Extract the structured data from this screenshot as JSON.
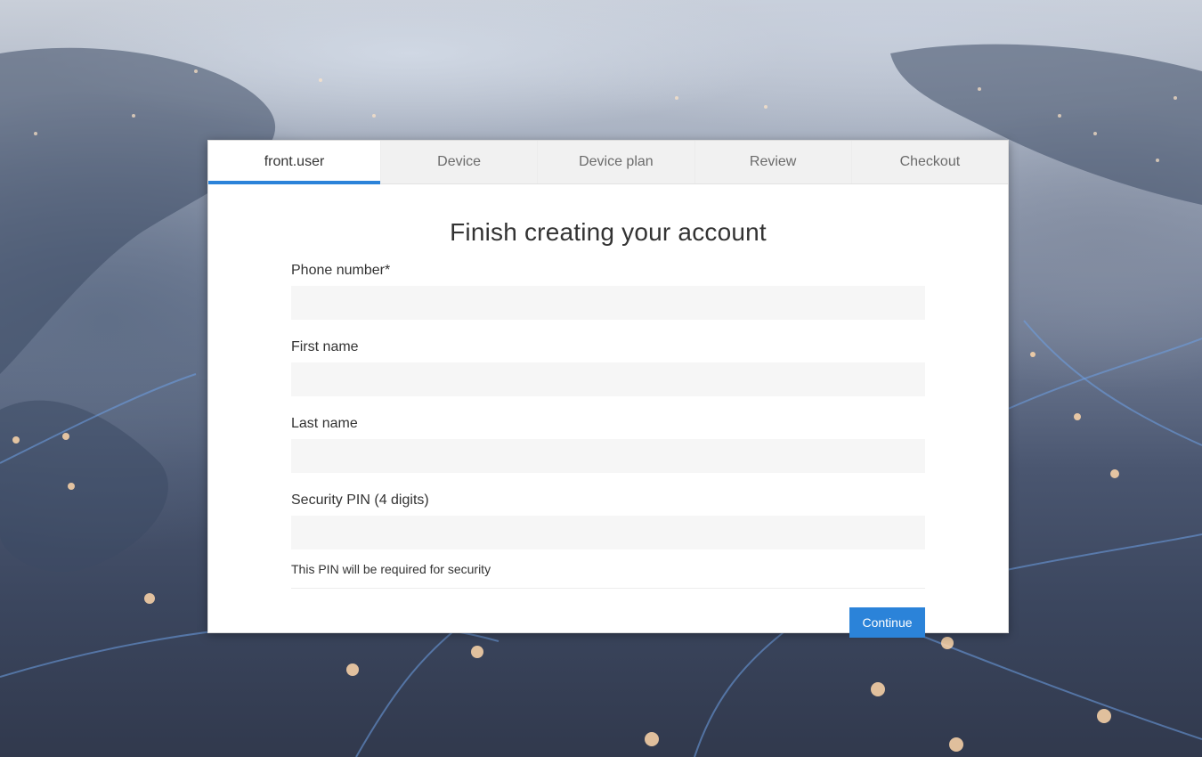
{
  "tabs": [
    {
      "label": "front.user",
      "active": true
    },
    {
      "label": "Device",
      "active": false
    },
    {
      "label": "Device plan",
      "active": false
    },
    {
      "label": "Review",
      "active": false
    },
    {
      "label": "Checkout",
      "active": false
    }
  ],
  "form": {
    "title": "Finish creating your account",
    "fields": {
      "phone": {
        "label": "Phone number*",
        "value": "",
        "placeholder": ""
      },
      "first_name": {
        "label": "First name",
        "value": "",
        "placeholder": ""
      },
      "last_name": {
        "label": "Last name",
        "value": "",
        "placeholder": ""
      },
      "pin": {
        "label": "Security PIN (4 digits)",
        "value": "",
        "placeholder": "",
        "help": "This PIN will be required for security"
      }
    },
    "continue_label": "Continue"
  },
  "colors": {
    "accent": "#2b83d9",
    "input_bg": "#f6f6f6",
    "tab_bar_bg": "#f1f1f1"
  }
}
